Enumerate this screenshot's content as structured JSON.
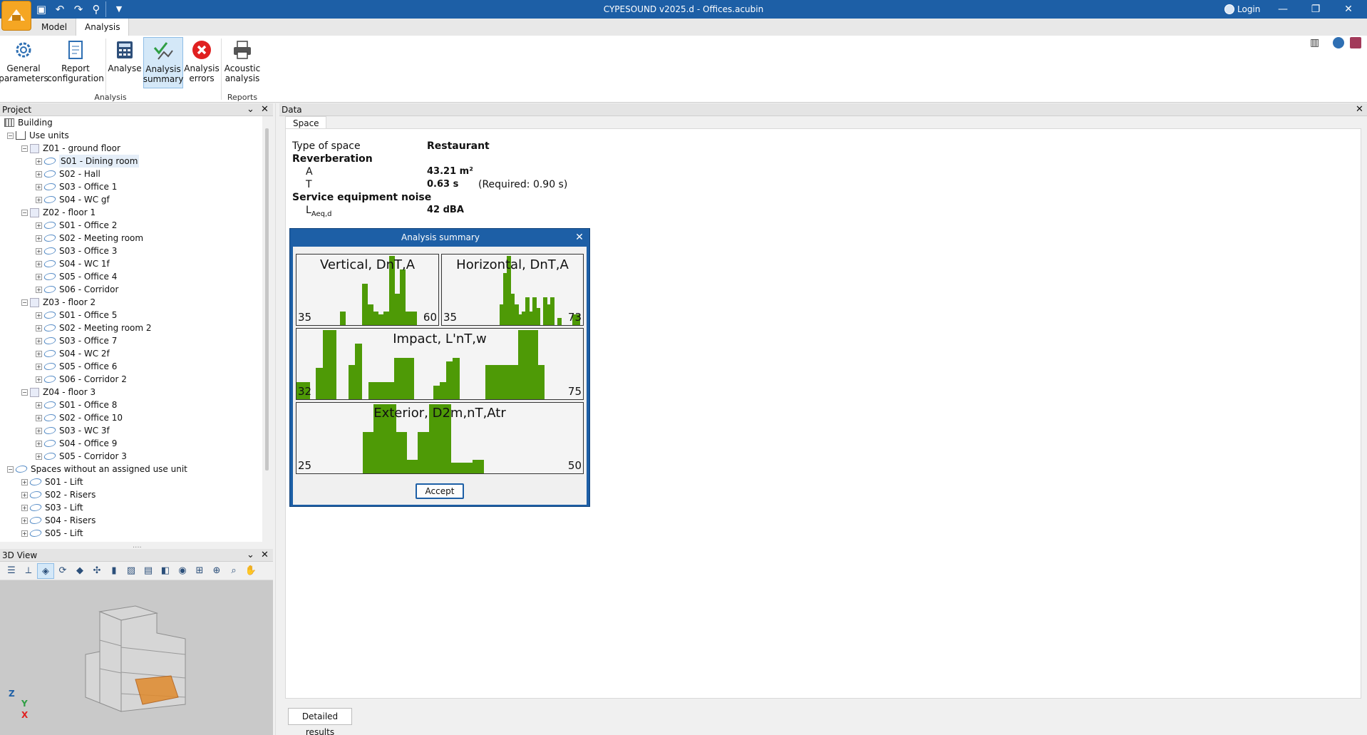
{
  "window": {
    "title": "CYPESOUND v2025.d - Offices.acubin",
    "login_label": "Login",
    "minimize": "—",
    "maximize": "❐",
    "close": "✕"
  },
  "tabs": [
    "Model",
    "Analysis"
  ],
  "ribbon": {
    "buttons": [
      {
        "label1": "General",
        "label2": "parameters"
      },
      {
        "label1": "Report",
        "label2": "configuration"
      },
      {
        "label1": "Analyse",
        "label2": ""
      },
      {
        "label1": "Analysis",
        "label2": "summary"
      },
      {
        "label1": "Analysis",
        "label2": "errors"
      },
      {
        "label1": "Acoustic",
        "label2": "analysis"
      }
    ],
    "group_analysis": "Analysis",
    "group_reports": "Reports"
  },
  "project_panel": {
    "title": "Project"
  },
  "tree": [
    {
      "label": "Building",
      "level": 0,
      "icon": "building"
    },
    {
      "label": "Use units",
      "level": 1,
      "icon": "home",
      "exp": "−"
    },
    {
      "label": "Z01 - ground floor",
      "level": 2,
      "icon": "box",
      "exp": "−"
    },
    {
      "label": "S01 - Dining room",
      "level": 3,
      "icon": "space",
      "exp": "+",
      "selected": true
    },
    {
      "label": "S02 - Hall",
      "level": 3,
      "icon": "space",
      "exp": "+"
    },
    {
      "label": "S03 - Office 1",
      "level": 3,
      "icon": "space",
      "exp": "+"
    },
    {
      "label": "S04 - WC gf",
      "level": 3,
      "icon": "space",
      "exp": "+"
    },
    {
      "label": "Z02 - floor 1",
      "level": 2,
      "icon": "box",
      "exp": "−"
    },
    {
      "label": "S01 - Office 2",
      "level": 3,
      "icon": "space",
      "exp": "+"
    },
    {
      "label": "S02 - Meeting room",
      "level": 3,
      "icon": "space",
      "exp": "+"
    },
    {
      "label": "S03 - Office 3",
      "level": 3,
      "icon": "space",
      "exp": "+"
    },
    {
      "label": "S04 - WC 1f",
      "level": 3,
      "icon": "space",
      "exp": "+"
    },
    {
      "label": "S05 - Office 4",
      "level": 3,
      "icon": "space",
      "exp": "+"
    },
    {
      "label": "S06 - Corridor",
      "level": 3,
      "icon": "space",
      "exp": "+"
    },
    {
      "label": "Z03 - floor 2",
      "level": 2,
      "icon": "box",
      "exp": "−"
    },
    {
      "label": "S01 - Office 5",
      "level": 3,
      "icon": "space",
      "exp": "+"
    },
    {
      "label": "S02 - Meeting room 2",
      "level": 3,
      "icon": "space",
      "exp": "+"
    },
    {
      "label": "S03 - Office 7",
      "level": 3,
      "icon": "space",
      "exp": "+"
    },
    {
      "label": "S04 - WC 2f",
      "level": 3,
      "icon": "space",
      "exp": "+"
    },
    {
      "label": "S05 - Office 6",
      "level": 3,
      "icon": "space",
      "exp": "+"
    },
    {
      "label": "S06 - Corridor 2",
      "level": 3,
      "icon": "space",
      "exp": "+"
    },
    {
      "label": "Z04 - floor 3",
      "level": 2,
      "icon": "box",
      "exp": "−"
    },
    {
      "label": "S01 - Office 8",
      "level": 3,
      "icon": "space",
      "exp": "+"
    },
    {
      "label": "S02 - Office 10",
      "level": 3,
      "icon": "space",
      "exp": "+"
    },
    {
      "label": "S03 - WC 3f",
      "level": 3,
      "icon": "space",
      "exp": "+"
    },
    {
      "label": "S04 - Office 9",
      "level": 3,
      "icon": "space",
      "exp": "+"
    },
    {
      "label": "S05 - Corridor 3",
      "level": 3,
      "icon": "space",
      "exp": "+"
    },
    {
      "label": "Spaces without an assigned use unit",
      "level": 1,
      "icon": "space",
      "exp": "−"
    },
    {
      "label": "S01 - Lift",
      "level": 2,
      "icon": "space",
      "exp": "+"
    },
    {
      "label": "S02 - Risers",
      "level": 2,
      "icon": "space",
      "exp": "+"
    },
    {
      "label": "S03 - Lift",
      "level": 2,
      "icon": "space",
      "exp": "+"
    },
    {
      "label": "S04 - Risers",
      "level": 2,
      "icon": "space",
      "exp": "+"
    },
    {
      "label": "S05 - Lift",
      "level": 2,
      "icon": "space",
      "exp": "+"
    }
  ],
  "view3d": {
    "title": "3D View"
  },
  "data_panel": {
    "title": "Data",
    "tab": "Space"
  },
  "space": {
    "type_label": "Type of space",
    "type_value": "Restaurant",
    "reverb_heading": "Reverberation",
    "a_label": "A",
    "a_value": "43.21 m²",
    "t_label": "T",
    "t_value": "0.63 s",
    "t_required": "(Required: 0.90 s)",
    "noise_heading": "Service equipment noise",
    "laeq_label": "L",
    "laeq_sub": "Aeq,d",
    "laeq_value": "42 dBA"
  },
  "dialog": {
    "title": "Analysis summary",
    "accept": "Accept"
  },
  "chart_data": [
    {
      "type": "bar",
      "title": "Vertical, DnT,A",
      "xlim": [
        35,
        60
      ],
      "min_label": "35",
      "max_label": "60",
      "x": [
        43,
        47,
        48,
        49,
        50,
        51,
        52,
        53,
        54,
        55,
        56
      ],
      "values": [
        20,
        60,
        30,
        20,
        15,
        20,
        100,
        45,
        80,
        20,
        20
      ]
    },
    {
      "type": "bar",
      "title": "Horizontal, DnT,A",
      "xlim": [
        35,
        73
      ],
      "min_label": "35",
      "max_label": "73",
      "x": [
        51,
        52,
        53,
        54,
        55,
        56,
        57,
        58,
        59,
        60,
        61,
        63,
        64,
        65,
        67,
        71,
        72
      ],
      "values": [
        30,
        75,
        100,
        45,
        30,
        15,
        20,
        40,
        20,
        40,
        25,
        40,
        30,
        40,
        10,
        15,
        15
      ]
    },
    {
      "type": "bar",
      "title": "Impact, L'nT,w",
      "xlim": [
        32,
        75
      ],
      "min_label": "32",
      "max_label": "75",
      "x": [
        32,
        33,
        35,
        36,
        37,
        40,
        41,
        43,
        44,
        45,
        46,
        47,
        48,
        49,
        53,
        54,
        55,
        56,
        61,
        62,
        63,
        64,
        65,
        66,
        67,
        68,
        69
      ],
      "values": [
        25,
        25,
        45,
        100,
        100,
        50,
        80,
        25,
        25,
        25,
        25,
        60,
        60,
        60,
        20,
        25,
        55,
        60,
        50,
        50,
        50,
        50,
        50,
        100,
        100,
        100,
        50
      ]
    },
    {
      "type": "bar",
      "title": "Exterior, D2m,nT,Atr",
      "xlim": [
        25,
        50
      ],
      "min_label": "25",
      "max_label": "50",
      "x": [
        31,
        32,
        33,
        34,
        35,
        36,
        37,
        38,
        39,
        40,
        41
      ],
      "values": [
        60,
        100,
        100,
        60,
        20,
        60,
        100,
        100,
        15,
        15,
        20
      ]
    }
  ],
  "bottom": {
    "detailed_results": "Detailed results"
  },
  "colors": {
    "titlebar": "#1d5fa6",
    "bars": "#4e9a06",
    "accent": "#f5a623"
  }
}
